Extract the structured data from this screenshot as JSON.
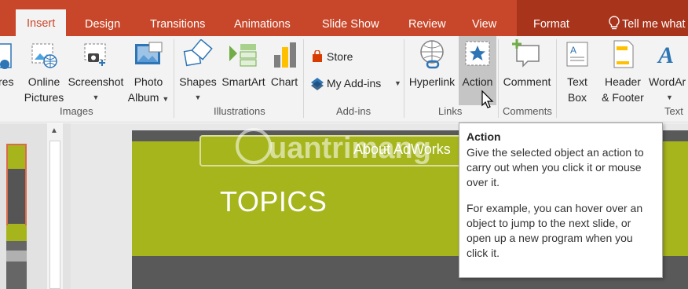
{
  "tabs": {
    "insert": "Insert",
    "design": "Design",
    "transitions": "Transitions",
    "animations": "Animations",
    "slide_show": "Slide Show",
    "review": "Review",
    "view": "View",
    "format": "Format",
    "tell_me": "Tell me what y"
  },
  "ribbon": {
    "images": {
      "label": "Images",
      "pictures_line1": "res",
      "online_pictures_line1": "Online",
      "online_pictures_line2": "Pictures",
      "screenshot": "Screenshot",
      "photo_album_line1": "Photo",
      "photo_album_line2": "Album"
    },
    "illustrations": {
      "label": "Illustrations",
      "shapes": "Shapes",
      "smartart": "SmartArt",
      "chart": "Chart"
    },
    "addins": {
      "label": "Add-ins",
      "store": "Store",
      "my_addins": "My Add-ins"
    },
    "links": {
      "label": "Links",
      "hyperlink": "Hyperlink",
      "action": "Action"
    },
    "comments": {
      "label": "Comments",
      "comment": "Comment"
    },
    "text": {
      "label": "Text",
      "textbox_line1": "Text",
      "textbox_line2": "Box",
      "header_line1": "Header",
      "header_line2": "& Footer",
      "wordart": "WordAr"
    }
  },
  "slide": {
    "title": "TOPICS",
    "box_text": "About AdWorks"
  },
  "watermark": "uantrimang",
  "tooltip": {
    "title": "Action",
    "para1": "Give the selected object an action to carry out when you click it or mouse over it.",
    "para2": "For example, you can hover over an object to jump to the next slide, or open up a new program when you click it."
  },
  "colors": {
    "accent": "#c8472a",
    "slide_green": "#a5b51b",
    "slide_dark": "#595959"
  }
}
